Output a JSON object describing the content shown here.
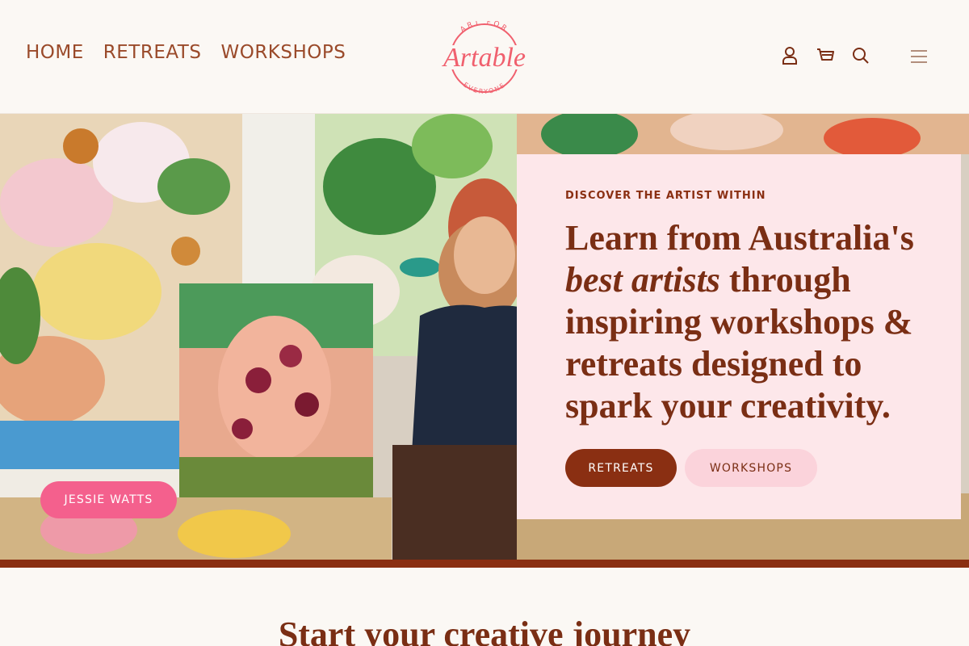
{
  "nav": {
    "items": [
      {
        "label": "HOME"
      },
      {
        "label": "RETREATS"
      },
      {
        "label": "WORKSHOPS"
      }
    ]
  },
  "logo": {
    "wordmark": "Artable",
    "ring_top": "ART FOR",
    "ring_bottom": "EVERYONE"
  },
  "header_icons": [
    "account-icon",
    "cart-icon",
    "search-icon",
    "menu-icon"
  ],
  "hero": {
    "eyebrow": "DISCOVER THE ARTIST WITHIN",
    "headline_part1": "Learn from Australia's",
    "headline_em": "best artists",
    "headline_part2": "through inspiring workshops & retreats designed to spark your creativity.",
    "primary_button": "RETREATS",
    "secondary_button": "WORKSHOPS",
    "artist_tag": "JESSIE WATTS"
  },
  "section": {
    "title": "Start your creative journey"
  },
  "colors": {
    "brand": "#8a2f12",
    "accent_pink": "#f4608d",
    "panel_bg": "#fde7ea",
    "page_bg": "#fbf8f4"
  }
}
